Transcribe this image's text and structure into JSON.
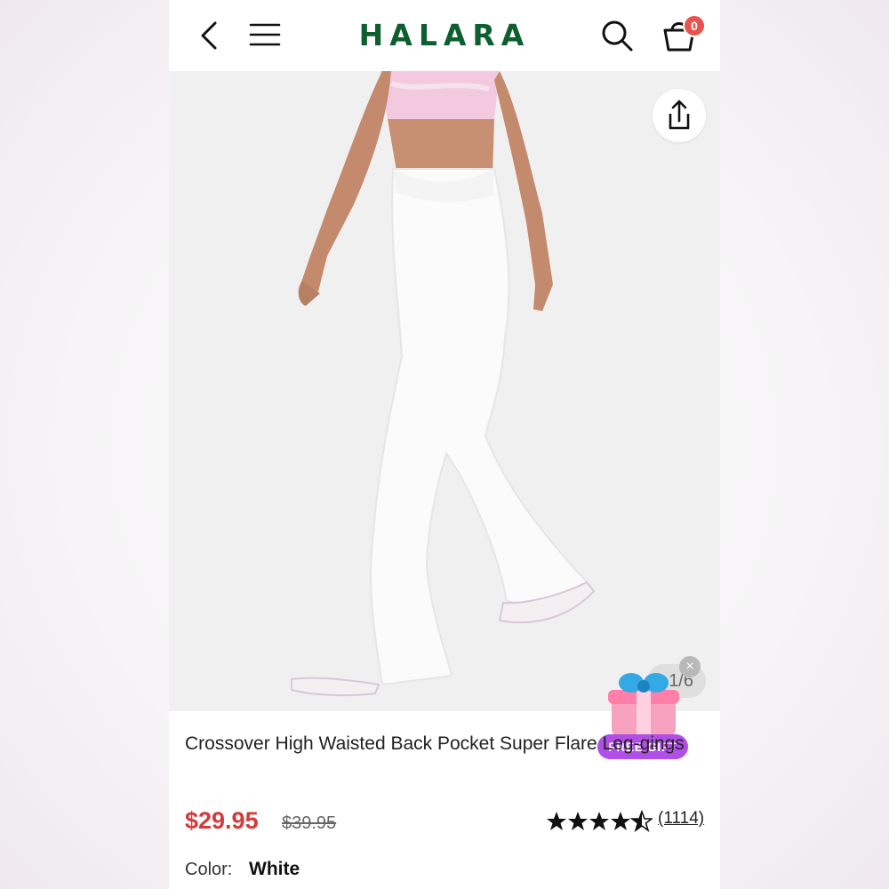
{
  "header": {
    "brand": "HALARA",
    "back_icon": "chevron-left-icon",
    "menu_icon": "hamburger-menu-icon",
    "search_icon": "search-icon",
    "cart_icon": "shopping-bag-icon",
    "cart_count": "0"
  },
  "gallery": {
    "share_icon": "share-icon",
    "counter": "1/6"
  },
  "promo": {
    "label": "FREE GIFT",
    "close": "×"
  },
  "product": {
    "title": "Crossover High Waisted Back Pocket Super Flare Leg-gings",
    "price": "$29.95",
    "original_price": "$39.95",
    "rating": 4.5,
    "review_count": "(1114)",
    "color_label": "Color:",
    "color_value": "White"
  },
  "colors": {
    "brand": "#0d5f2f",
    "price": "#d43a3a",
    "badge": "#e8524f",
    "gift_label": "#b14ee6"
  }
}
